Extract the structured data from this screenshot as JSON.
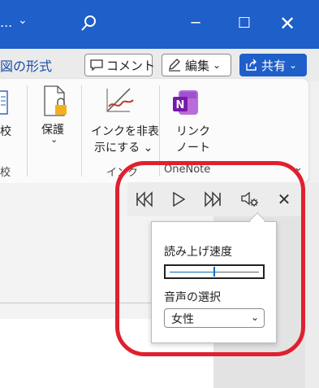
{
  "titlebar": {
    "title": "...",
    "chevron": "⌄",
    "search_icon": "search-icon",
    "minimize": "─",
    "maximize": "☐",
    "close": "✕",
    "bg_color": "#1e5fc9"
  },
  "header": {
    "ribbon_tab": "図の形式",
    "comment_label": "コメント",
    "edit_label": "編集",
    "share_label": "共有",
    "chevron": "⌄"
  },
  "ribbon": {
    "compare_label": "校",
    "compare_group": "校",
    "protect_label": "保護",
    "protect_chevron": "⌄",
    "ink_label_1": "インクを非表",
    "ink_label_2": "示にする ⌄",
    "ink_group": "インク",
    "link_label_1": "リンク",
    "link_label_2": "ノート",
    "onenote_group": "OneNote",
    "collapse_icon": "⌄"
  },
  "read_aloud": {
    "prev_icon": "skip-previous-icon",
    "play_icon": "play-icon",
    "next_icon": "skip-next-icon",
    "settings_icon": "voice-settings-icon",
    "close": "✕",
    "speed_label": "読み上げ速度",
    "speed_value": 0.5,
    "voice_label": "音声の選択",
    "voice_value": "女性",
    "voice_chevron": "⌄"
  },
  "annotation": {
    "color": "#e0202e"
  }
}
